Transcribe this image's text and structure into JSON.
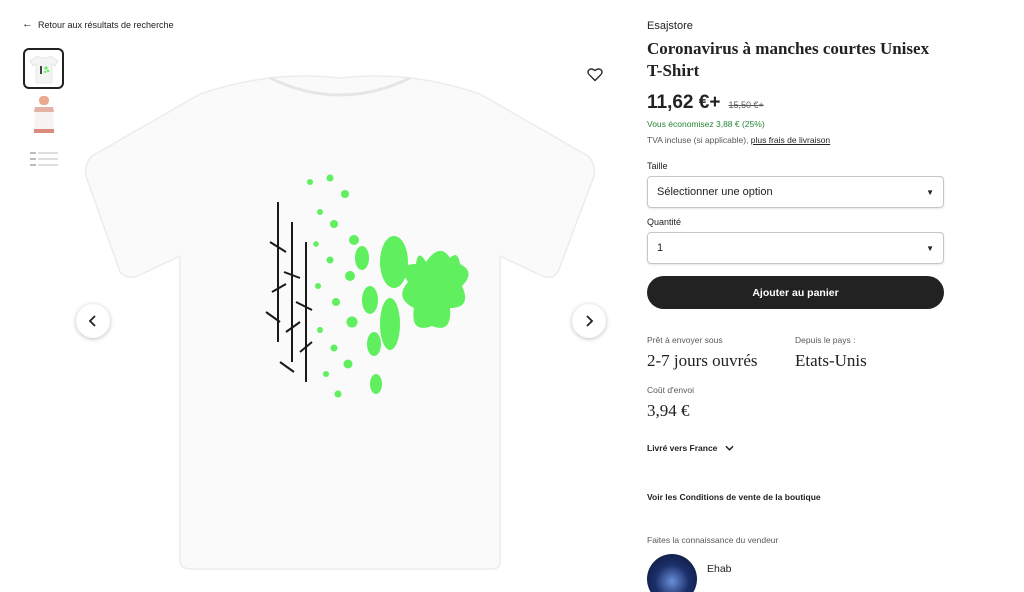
{
  "nav": {
    "back_label": "Retour aux résultats de recherche"
  },
  "gallery": {
    "thumbnails": [
      "T-shirt blanc",
      "Modèle portant le T-shirt",
      "Guide des tailles"
    ],
    "selected_index": 0
  },
  "product": {
    "shop": "Esajstore",
    "title": "Coronavirus à manches courtes Unisex T-Shirt",
    "price": "11,62 €+",
    "old_price": "15,50 €+",
    "savings": "Vous économisez 3,88 € (25%)",
    "tax_text": "TVA incluse (si applicable), ",
    "tax_link": "plus frais de livraison"
  },
  "options": {
    "size_label": "Taille",
    "size_value": "Sélectionner une option",
    "qty_label": "Quantité",
    "qty_value": "1"
  },
  "actions": {
    "add_to_cart": "Ajouter au panier"
  },
  "shipping": {
    "ready_label": "Prêt à envoyer sous",
    "ready_value": "2-7 jours ouvrés",
    "from_label": "Depuis le pays :",
    "from_value": "Etats-Unis",
    "cost_label": "Coût d'envoi",
    "cost_value": "3,94 €",
    "deliver_to": "Livré vers France"
  },
  "shop_info": {
    "terms_link": "Voir les Conditions de vente de la boutique",
    "meet_label": "Faites la connaissance du vendeur",
    "seller_name": "Ehab"
  },
  "colors": {
    "accent_green": "#5FEF5F",
    "button_dark": "#222222",
    "savings_green": "#258635"
  }
}
